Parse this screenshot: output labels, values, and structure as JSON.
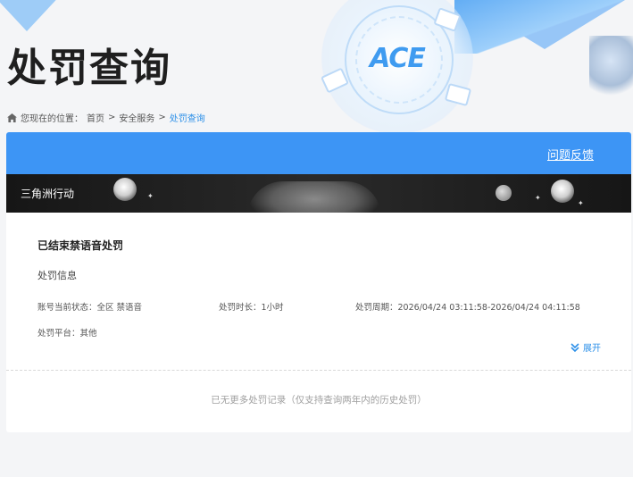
{
  "header": {
    "title": "处罚查询",
    "logo_text": "ACE"
  },
  "breadcrumb": {
    "prefix": "您现在的位置：",
    "items": [
      "首页",
      "安全服务",
      "处罚查询"
    ],
    "separator": ">"
  },
  "card": {
    "feedback_link": "问题反馈",
    "banner_title": "三角洲行动",
    "record": {
      "title": "已结束禁语音处罚",
      "section_label": "处罚信息",
      "fields": {
        "account_status_label": "账号当前状态：",
        "account_status_value": "全区 禁语音",
        "duration_label": "处罚时长：",
        "duration_value": "1小时",
        "period_label": "处罚周期：",
        "period_value": "2026/04/24 03:11:58-2026/04/24 04:11:58",
        "platform_label": "处罚平台：",
        "platform_value": "其他"
      },
      "expand_label": "展开"
    },
    "no_more_text": "已无更多处罚记录（仅支持查询两年内的历史处罚）"
  },
  "colors": {
    "accent": "#3d95f5",
    "link": "#2b8fe8",
    "banner_bg": "#161616"
  },
  "icons": [
    "home-icon",
    "chevron-down-double-icon"
  ]
}
